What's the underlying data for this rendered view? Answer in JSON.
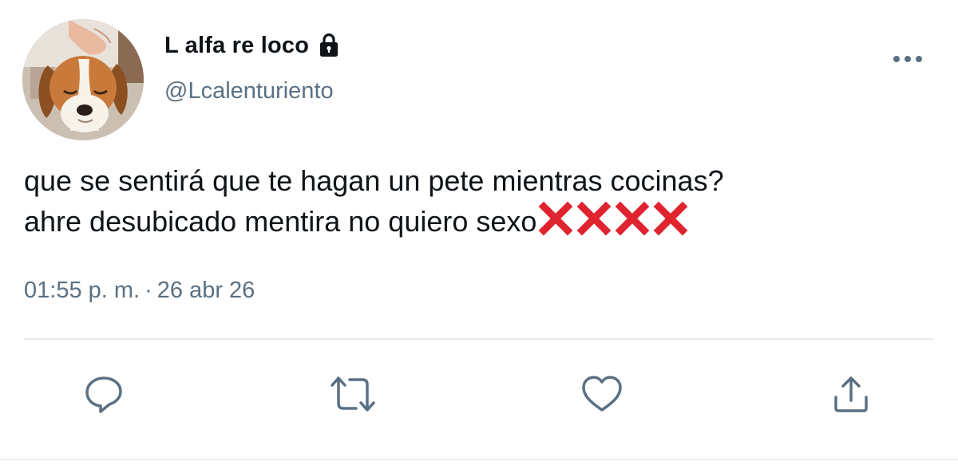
{
  "user": {
    "display_name": "L alfa re loco",
    "handle": "@Lcalenturiento",
    "protected_icon": "lock-icon",
    "avatar": "dog-photo"
  },
  "tweet": {
    "line1": "que se sentirá que te hagan un pete mientras cocinas?",
    "line2": "ahre desubicado mentira no quiero sexo",
    "emoji": "❌❌❌❌",
    "time": "01:55 p. m.",
    "separator": "·",
    "date": "26 abr 26"
  },
  "actions": {
    "reply": "reply-icon",
    "retweet": "retweet-icon",
    "like": "heart-icon",
    "share": "share-icon",
    "more": "more-icon"
  },
  "colors": {
    "text": "#0f1419",
    "secondary": "#5b7083",
    "icon": "#5b7083",
    "x_mark": "#e0242f",
    "divider": "#e6ecf0"
  }
}
